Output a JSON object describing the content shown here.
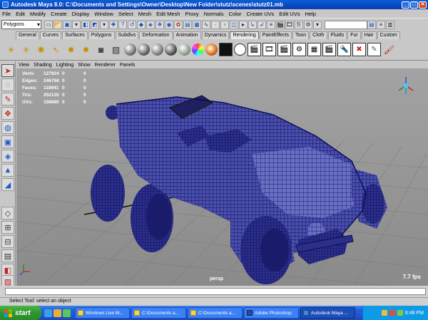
{
  "window": {
    "title": "Autodesk Maya 8.0: C:\\Documents and Settings\\Owner\\Desktop\\New Folder\\stutz\\scenes\\stutz01.mb",
    "buttons": [
      "_",
      "□",
      "✕"
    ]
  },
  "menubar": [
    "File",
    "Edit",
    "Modify",
    "Create",
    "Display",
    "Window",
    "Select",
    "Mesh",
    "Edit Mesh",
    "Proxy",
    "Normals",
    "Color",
    "Create UVs",
    "Edit UVs",
    "Help"
  ],
  "statusline": {
    "mode": "Polygons"
  },
  "shelf": {
    "tabs": [
      "General",
      "Curves",
      "Surfaces",
      "Polygons",
      "Subdivs",
      "Deformation",
      "Animation",
      "Dynamics",
      "Rendering",
      "PaintEffects",
      "Toon",
      "Cloth",
      "Fluids",
      "Fur",
      "Hair",
      "Custom"
    ],
    "active_tab": "Rendering"
  },
  "panel_menu": [
    "View",
    "Shading",
    "Lighting",
    "Show",
    "Renderer",
    "Panels"
  ],
  "hud": {
    "rows": [
      {
        "label": "Verts:",
        "value": "127924",
        "a": "0",
        "b": "0"
      },
      {
        "label": "Edges:",
        "value": "246768",
        "a": "0",
        "b": "0"
      },
      {
        "label": "Faces:",
        "value": "118941",
        "a": "0",
        "b": "0"
      },
      {
        "label": "Tris:",
        "value": "252135",
        "a": "0",
        "b": "0"
      },
      {
        "label": "UVs:",
        "value": "158880",
        "a": "0",
        "b": "0"
      }
    ]
  },
  "viewport": {
    "camera": "persp",
    "fps": "7.7 fps"
  },
  "helpline": "Select Tool: select an object",
  "taskbar": {
    "start": "start",
    "tasks": [
      {
        "label": "Windows Live M...",
        "active": false
      },
      {
        "label": "C:\\Documents a...",
        "active": false
      },
      {
        "label": "C:\\Documents a...",
        "active": false
      },
      {
        "label": "Adobe Photoshop",
        "active": false
      },
      {
        "label": "Autodesk Maya ...",
        "active": true
      }
    ],
    "clock": "6:48 PM"
  },
  "colors": {
    "wire": "#1a1a8a",
    "xp_blue": "#245edb",
    "viewport_bg": "#9a9a9a"
  }
}
